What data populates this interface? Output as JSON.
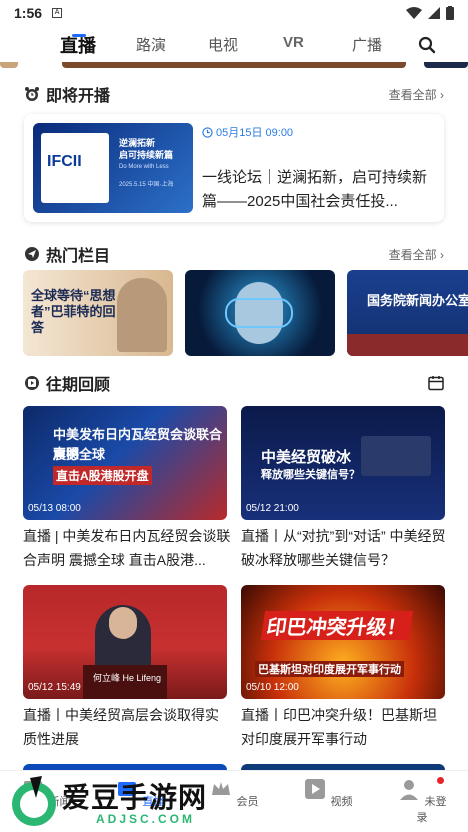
{
  "status": {
    "time": "1:56",
    "sim": "A"
  },
  "tabs": [
    {
      "label": "直播"
    },
    {
      "label": "路演"
    },
    {
      "label": "电视"
    },
    {
      "label": "VR"
    },
    {
      "label": "广播"
    }
  ],
  "sections": {
    "upcoming": {
      "title": "即将开播",
      "more": "查看全部"
    },
    "hot": {
      "title": "热门栏目",
      "more": "查看全部"
    },
    "replay": {
      "title": "往期回顾"
    }
  },
  "upcoming_card": {
    "time": "05月15日 09:00",
    "title": "一线论坛｜逆澜拓新，启可持续新篇——2025中国社会责任投...",
    "thumb_logo": "IFCII",
    "thumb_line1": "逆澜拓新",
    "thumb_line2": "启可持续新篇",
    "thumb_line3": "Do More with Less",
    "thumb_line4": "2025.5.15 中国·上海"
  },
  "hot_items": [
    {
      "caption": "全球等待“思想者”巴菲特的回答"
    },
    {
      "caption": ""
    },
    {
      "caption": "国务院新闻办公室"
    }
  ],
  "replay_items": [
    {
      "time": "05/13 08:00",
      "title": "直播 | 中美发布日内瓦经贸会谈联合声明 震撼全球 直击A股港...",
      "thumb_text": "中美发布日内瓦经贸会谈联合声明",
      "thumb_sub": "震撼全球",
      "thumb_sub2": "直击A股港股开盘"
    },
    {
      "time": "05/12 21:00",
      "title": "直播丨从“对抗”到“对话” 中美经贸破冰释放哪些关键信号？",
      "thumb_text": "中美经贸破冰",
      "thumb_sub": "释放哪些关键信号？",
      "thumb_sub2": ""
    },
    {
      "time": "05/12 15:49",
      "title": "直播丨中美经贸高层会谈取得实质性进展",
      "thumb_text": "He Lifeng",
      "thumb_sub": "何立峰",
      "thumb_sub2": ""
    },
    {
      "time": "05/10 12:00",
      "title": "直播丨印巴冲突升级！巴基斯坦对印度展开军事行动",
      "thumb_text": "印巴冲突升级！",
      "thumb_sub": "巴基斯坦对印度展开军事行动",
      "thumb_sub2": ""
    }
  ],
  "bottom_nav": [
    {
      "label": "新闻"
    },
    {
      "label": "直播"
    },
    {
      "label": "会员"
    },
    {
      "label": "视频"
    },
    {
      "label": "未登录"
    }
  ],
  "watermark": {
    "text": "爱豆手游网",
    "sub": "ADJSC.COM"
  },
  "colors": {
    "accent": "#1e6bff",
    "time_blue": "#2a7de1"
  }
}
